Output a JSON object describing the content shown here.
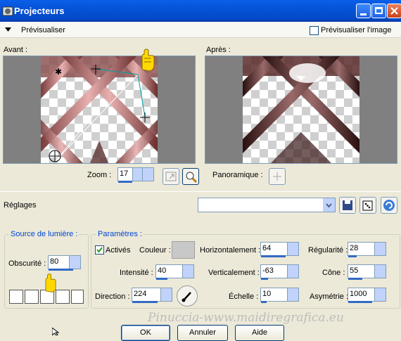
{
  "window": {
    "title": "Projecteurs"
  },
  "preview": {
    "toggle_label": "Prévisualiser",
    "checkbox_label": "Prévisualiser l'image",
    "checked": false
  },
  "panels": {
    "before_label": "Avant :",
    "after_label": "Après :"
  },
  "zoom": {
    "label": "Zoom :",
    "value": "17"
  },
  "pan": {
    "label": "Panoramique :"
  },
  "settings": {
    "label": "Réglages",
    "preset_value": ""
  },
  "light_source": {
    "legend": "Source de lumière :",
    "darkness_label": "Obscurité :",
    "darkness_value": "80"
  },
  "params": {
    "legend": "Paramètres :",
    "active_label": "Activés",
    "active_checked": true,
    "color_label": "Couleur :",
    "color_value": "#c8c8c8",
    "intensity_label": "Intensité :",
    "intensity_value": "40",
    "direction_label": "Direction :",
    "direction_value": "224",
    "horizontal_label": "Horizontalement :",
    "horizontal_value": "64",
    "vertical_label": "Verticalement :",
    "vertical_value": "-63",
    "scale_label": "Échelle :",
    "scale_value": "10",
    "regularity_label": "Régularité :",
    "regularity_value": "28",
    "cone_label": "Cône :",
    "cone_value": "55",
    "asymmetry_label": "Asymétrie :",
    "asymmetry_value": "1000"
  },
  "buttons": {
    "ok": "OK",
    "cancel": "Annuler",
    "help": "Aide"
  },
  "watermark": "Pinuccia-www.maidiregrafica.eu"
}
